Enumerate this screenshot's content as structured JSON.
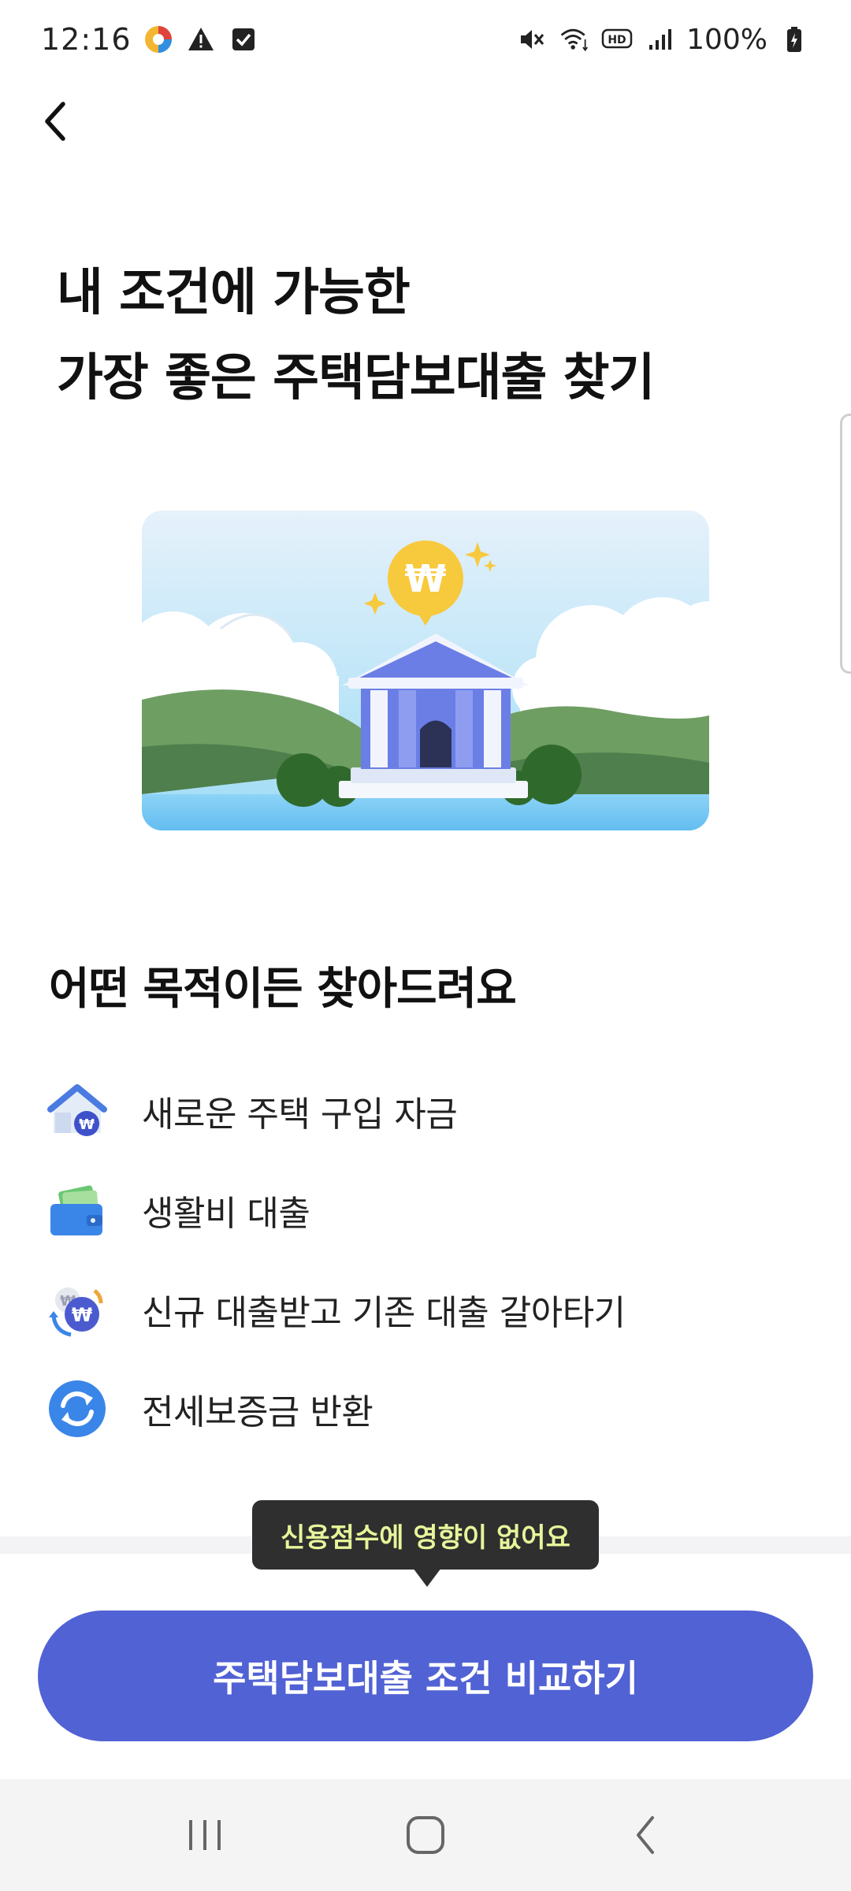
{
  "status_bar": {
    "time": "12:16",
    "battery": "100%",
    "icons": [
      "app-icon",
      "warning-icon",
      "checkbox-icon",
      "mute-icon",
      "wifi-icon",
      "hd-icon",
      "signal-icon",
      "battery-icon"
    ]
  },
  "header": {
    "back_icon": "back-arrow-icon"
  },
  "title": {
    "line1": "내 조건에 가능한",
    "line2": "가장 좋은 주택담보대출 찾기"
  },
  "hero": {
    "illustration": "bank-illustration",
    "coin_symbol": "₩"
  },
  "section": {
    "title": "어떤 목적이든 찾아드려요"
  },
  "purposes": [
    {
      "label": "새로운 주택 구입 자금",
      "icon": "house-won-icon"
    },
    {
      "label": "생활비 대출",
      "icon": "wallet-icon"
    },
    {
      "label": "신규 대출받고 기존 대출 갈아타기",
      "icon": "exchange-won-icon"
    },
    {
      "label": "전세보증금 반환",
      "icon": "refresh-icon"
    }
  ],
  "tooltip": {
    "text": "신용점수에 영향이 없어요"
  },
  "cta": {
    "label": "주택담보대출 조건 비교하기"
  },
  "colors": {
    "primary": "#5162d4",
    "tooltip_bg": "#2f2f2f",
    "tooltip_text": "#e6f59a"
  }
}
